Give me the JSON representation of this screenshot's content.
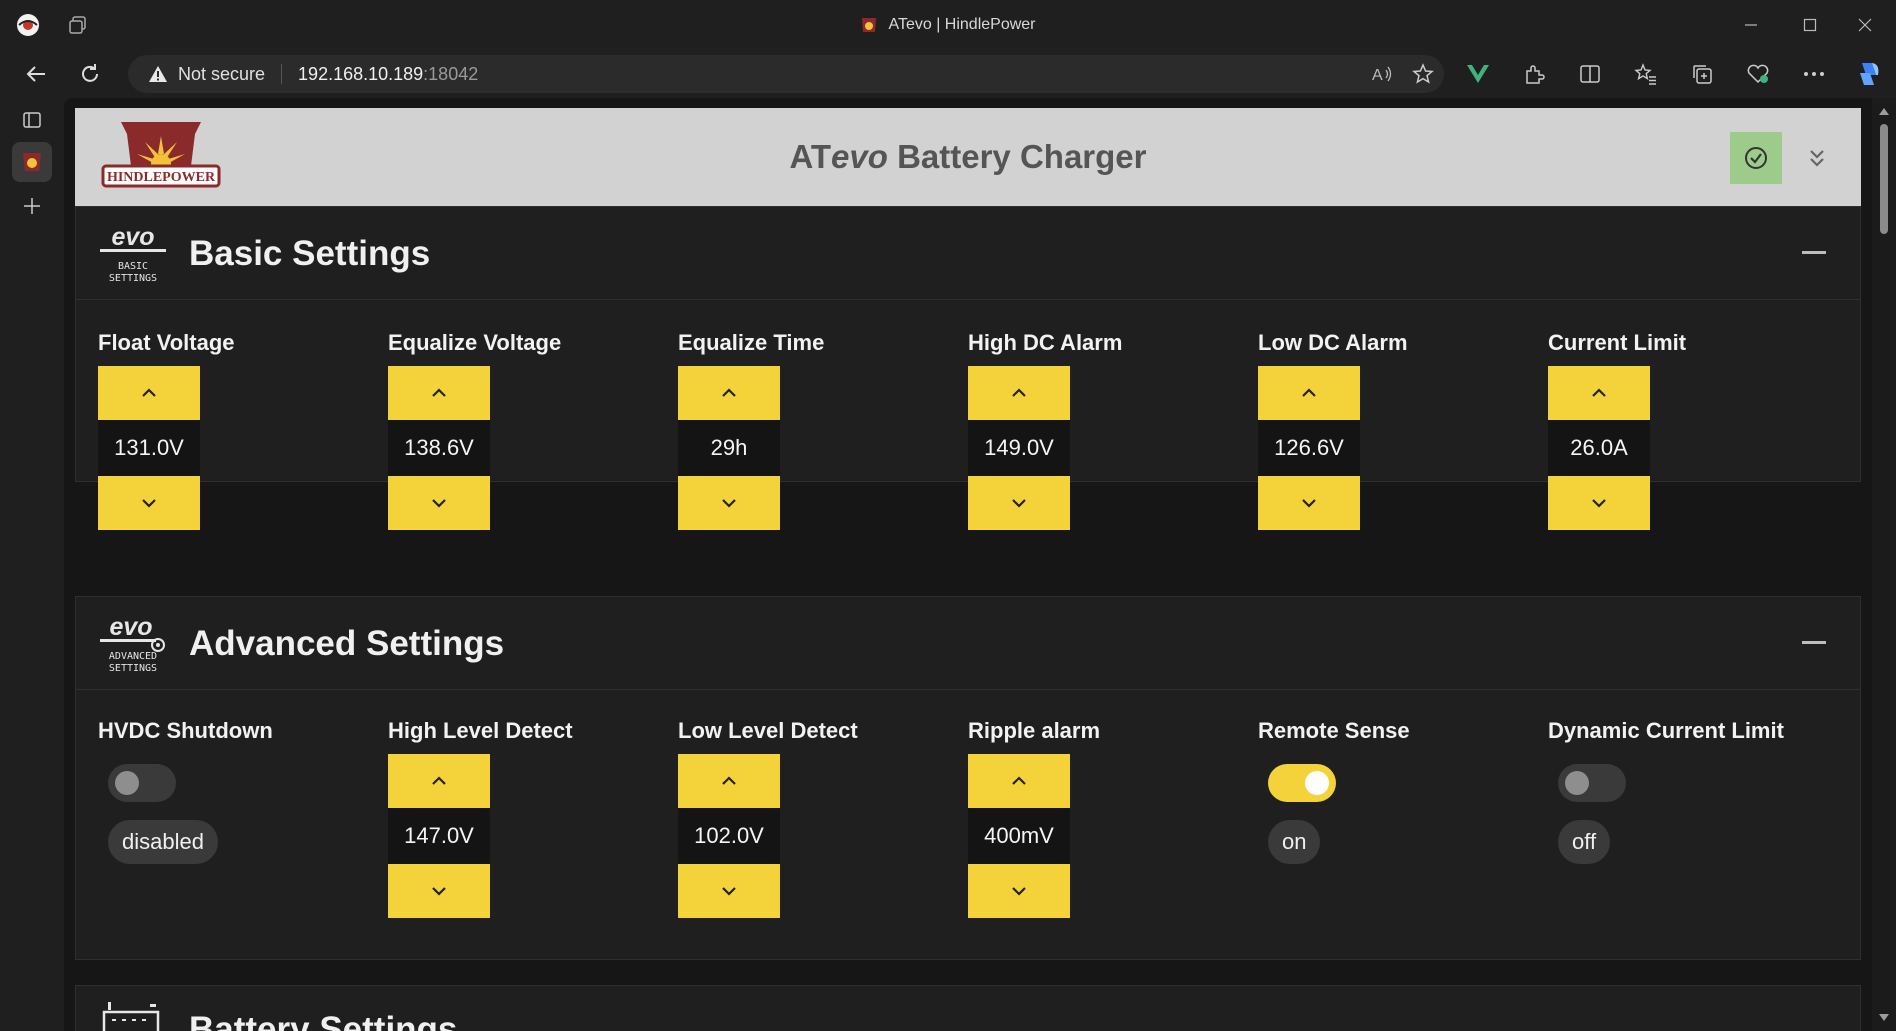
{
  "browser": {
    "tab_title": "ATevo | HindlePower",
    "security_label": "Not secure",
    "url_host": "192.168.10.189",
    "url_port": ":18042"
  },
  "app": {
    "title_prefix": "AT",
    "title_italic": "evo",
    "title_suffix": " Battery Charger",
    "logo_text": "HINDLEPOWER"
  },
  "basic": {
    "icon_text": "evo",
    "icon_caption_1": "BASIC",
    "icon_caption_2": "SETTINGS",
    "title": "Basic Settings",
    "settings": [
      {
        "label": "Float Voltage",
        "value": "131.0V"
      },
      {
        "label": "Equalize Voltage",
        "value": "138.6V"
      },
      {
        "label": "Equalize Time",
        "value": "29h"
      },
      {
        "label": "High DC Alarm",
        "value": "149.0V"
      },
      {
        "label": "Low DC Alarm",
        "value": "126.6V"
      },
      {
        "label": "Current Limit",
        "value": "26.0A"
      }
    ]
  },
  "advanced": {
    "icon_text": "evo",
    "icon_caption_1": "ADVANCED",
    "icon_caption_2": "SETTINGS",
    "title": "Advanced Settings",
    "hvdc": {
      "label": "HVDC Shutdown",
      "state": "disabled",
      "enabled": false
    },
    "steppers": [
      {
        "label": "High Level Detect",
        "value": "147.0V"
      },
      {
        "label": "Low Level Detect",
        "value": "102.0V"
      },
      {
        "label": "Ripple alarm",
        "value": "400mV"
      }
    ],
    "remote_sense": {
      "label": "Remote Sense",
      "state": "on",
      "enabled": true
    },
    "dynamic_current": {
      "label": "Dynamic Current Limit",
      "state": "off",
      "enabled": false
    }
  },
  "battery": {
    "title": "Battery Settings"
  },
  "colors": {
    "accent_yellow": "#f3d339",
    "save_green": "#9ccb8a",
    "header_gray": "#d2d2d2"
  }
}
